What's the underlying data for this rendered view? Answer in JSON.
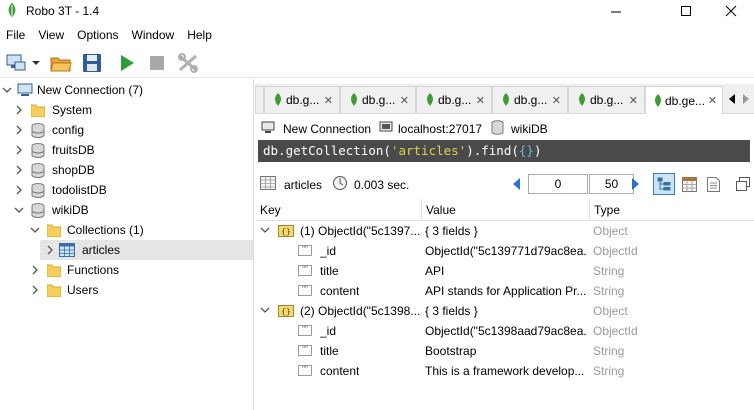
{
  "window": {
    "title": "Robo 3T - 1.4"
  },
  "menu": [
    "File",
    "View",
    "Options",
    "Window",
    "Help"
  ],
  "toolbar": {
    "buttons": [
      "connect-icon",
      "dropdown-icon",
      "open-folder-icon",
      "save-icon",
      "run-icon",
      "stop-icon",
      "format-icon"
    ]
  },
  "explorer": {
    "connection": "New Connection (7)",
    "databases": [
      "System",
      "config",
      "fruitsDB",
      "shopDB",
      "todolistDB",
      "wikiDB"
    ],
    "collections": "Collections (1)",
    "collection_item": "articles",
    "functions": "Functions",
    "users": "Users"
  },
  "tabs": [
    {
      "label": "db.g..."
    },
    {
      "label": "db.g..."
    },
    {
      "label": "db.g..."
    },
    {
      "label": "db.g..."
    },
    {
      "label": "db.g..."
    },
    {
      "label": "db.ge..."
    }
  ],
  "info": {
    "connection": "New Connection",
    "host": "localhost:27017",
    "database": "wikiDB"
  },
  "query": {
    "prefix": "db.getCollection(",
    "arg": "'articles'",
    "mid": ").find(",
    "braces": "{}",
    "suffix": ")"
  },
  "results": {
    "collection": "articles",
    "time": "0.003 sec.",
    "skip": "0",
    "limit": "50"
  },
  "grid": {
    "columns": {
      "key": "Key",
      "value": "Value",
      "type": "Type"
    },
    "rows": [
      {
        "key": "(1) ObjectId(\"5c1397...",
        "value": "{ 3 fields }",
        "type": "Object"
      },
      {
        "key": "_id",
        "value": "ObjectId(\"5c139771d79ac8ea...",
        "type": "ObjectId"
      },
      {
        "key": "title",
        "value": "API",
        "type": "String"
      },
      {
        "key": "content",
        "value": "API stands for Application Pr...",
        "type": "String"
      },
      {
        "key": "(2) ObjectId(\"5c1398...",
        "value": "{ 3 fields }",
        "type": "Object"
      },
      {
        "key": "_id",
        "value": "ObjectId(\"5c1398aad79ac8ea...",
        "type": "ObjectId"
      },
      {
        "key": "title",
        "value": "Bootstrap",
        "type": "String"
      },
      {
        "key": "content",
        "value": "This is a framework develop...",
        "type": "String"
      }
    ]
  },
  "colors": {
    "accent_green": "#3f9c35",
    "query_bg": "#4a4a4a",
    "nav_blue": "#2b6fd6"
  }
}
